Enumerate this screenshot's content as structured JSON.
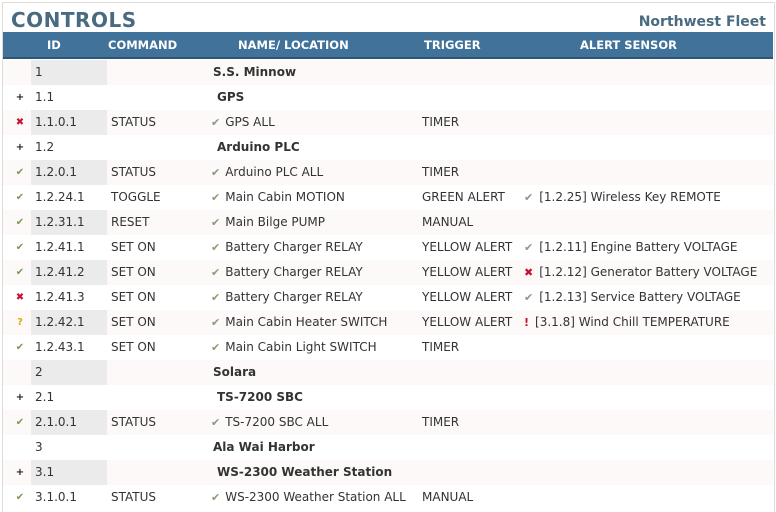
{
  "header": {
    "title": "CONTROLS",
    "fleet": "Northwest Fleet"
  },
  "columns": [
    "ID",
    "COMMAND",
    "NAME/ LOCATION",
    "TRIGGER",
    "ALERT SENSOR"
  ],
  "colors": {
    "header_bg": "#41729a",
    "ok": "#7a9a50",
    "error": "#c8102e",
    "warning": "#d8b000"
  },
  "rows": [
    {
      "status": "",
      "id": "1",
      "command": "",
      "name": "S.S. Minnow",
      "group": true,
      "trigger": "",
      "alert_status": "",
      "alert": ""
    },
    {
      "status": "plus",
      "id": "1.1",
      "command": "",
      "name": "GPS",
      "group": true,
      "trigger": "",
      "alert_status": "",
      "alert": ""
    },
    {
      "status": "error",
      "id": "1.1.0.1",
      "command": "STATUS",
      "name": "GPS ALL",
      "group": false,
      "trigger": "TIMER",
      "alert_status": "",
      "alert": ""
    },
    {
      "status": "plus",
      "id": "1.2",
      "command": "",
      "name": "Arduino PLC",
      "group": true,
      "trigger": "",
      "alert_status": "",
      "alert": ""
    },
    {
      "status": "ok",
      "id": "1.2.0.1",
      "command": "STATUS",
      "name": "Arduino PLC ALL",
      "group": false,
      "trigger": "TIMER",
      "alert_status": "",
      "alert": ""
    },
    {
      "status": "ok",
      "id": "1.2.24.1",
      "command": "TOGGLE",
      "name": "Main Cabin MOTION",
      "group": false,
      "trigger": "GREEN ALERT",
      "alert_status": "check",
      "alert": "[1.2.25] Wireless Key REMOTE"
    },
    {
      "status": "ok",
      "id": "1.2.31.1",
      "command": "RESET",
      "name": "Main Bilge PUMP",
      "group": false,
      "trigger": "MANUAL",
      "alert_status": "",
      "alert": ""
    },
    {
      "status": "ok",
      "id": "1.2.41.1",
      "command": "SET ON",
      "name": "Battery Charger RELAY",
      "group": false,
      "trigger": "YELLOW ALERT",
      "alert_status": "ok",
      "alert": "[1.2.11] Engine Battery VOLTAGE"
    },
    {
      "status": "ok",
      "id": "1.2.41.2",
      "command": "SET ON",
      "name": "Battery Charger RELAY",
      "group": false,
      "trigger": "YELLOW ALERT",
      "alert_status": "error",
      "alert": "[1.2.12] Generator Battery VOLTAGE"
    },
    {
      "status": "error",
      "id": "1.2.41.3",
      "command": "SET ON",
      "name": "Battery Charger RELAY",
      "group": false,
      "trigger": "YELLOW ALERT",
      "alert_status": "ok",
      "alert": "[1.2.13] Service Battery VOLTAGE"
    },
    {
      "status": "warn",
      "id": "1.2.42.1",
      "command": "SET ON",
      "name": "Main Cabin Heater SWITCH",
      "group": false,
      "trigger": "YELLOW ALERT",
      "alert_status": "alert",
      "alert": "[3.1.8] Wind Chill TEMPERATURE"
    },
    {
      "status": "ok",
      "id": "1.2.43.1",
      "command": "SET ON",
      "name": "Main Cabin Light SWITCH",
      "group": false,
      "trigger": "TIMER",
      "alert_status": "",
      "alert": ""
    },
    {
      "status": "",
      "id": "2",
      "command": "",
      "name": "Solara",
      "group": true,
      "trigger": "",
      "alert_status": "",
      "alert": ""
    },
    {
      "status": "plus",
      "id": "2.1",
      "command": "",
      "name": "TS-7200 SBC",
      "group": true,
      "trigger": "",
      "alert_status": "",
      "alert": ""
    },
    {
      "status": "ok",
      "id": "2.1.0.1",
      "command": "STATUS",
      "name": "TS-7200 SBC ALL",
      "group": false,
      "trigger": "TIMER",
      "alert_status": "",
      "alert": ""
    },
    {
      "status": "",
      "id": "3",
      "command": "",
      "name": "Ala Wai Harbor",
      "group": true,
      "trigger": "",
      "alert_status": "",
      "alert": ""
    },
    {
      "status": "plus",
      "id": "3.1",
      "command": "",
      "name": "WS-2300 Weather Station",
      "group": true,
      "trigger": "",
      "alert_status": "",
      "alert": ""
    },
    {
      "status": "ok",
      "id": "3.1.0.1",
      "command": "STATUS",
      "name": "WS-2300 Weather Station ALL",
      "group": false,
      "trigger": "MANUAL",
      "alert_status": "",
      "alert": ""
    }
  ]
}
